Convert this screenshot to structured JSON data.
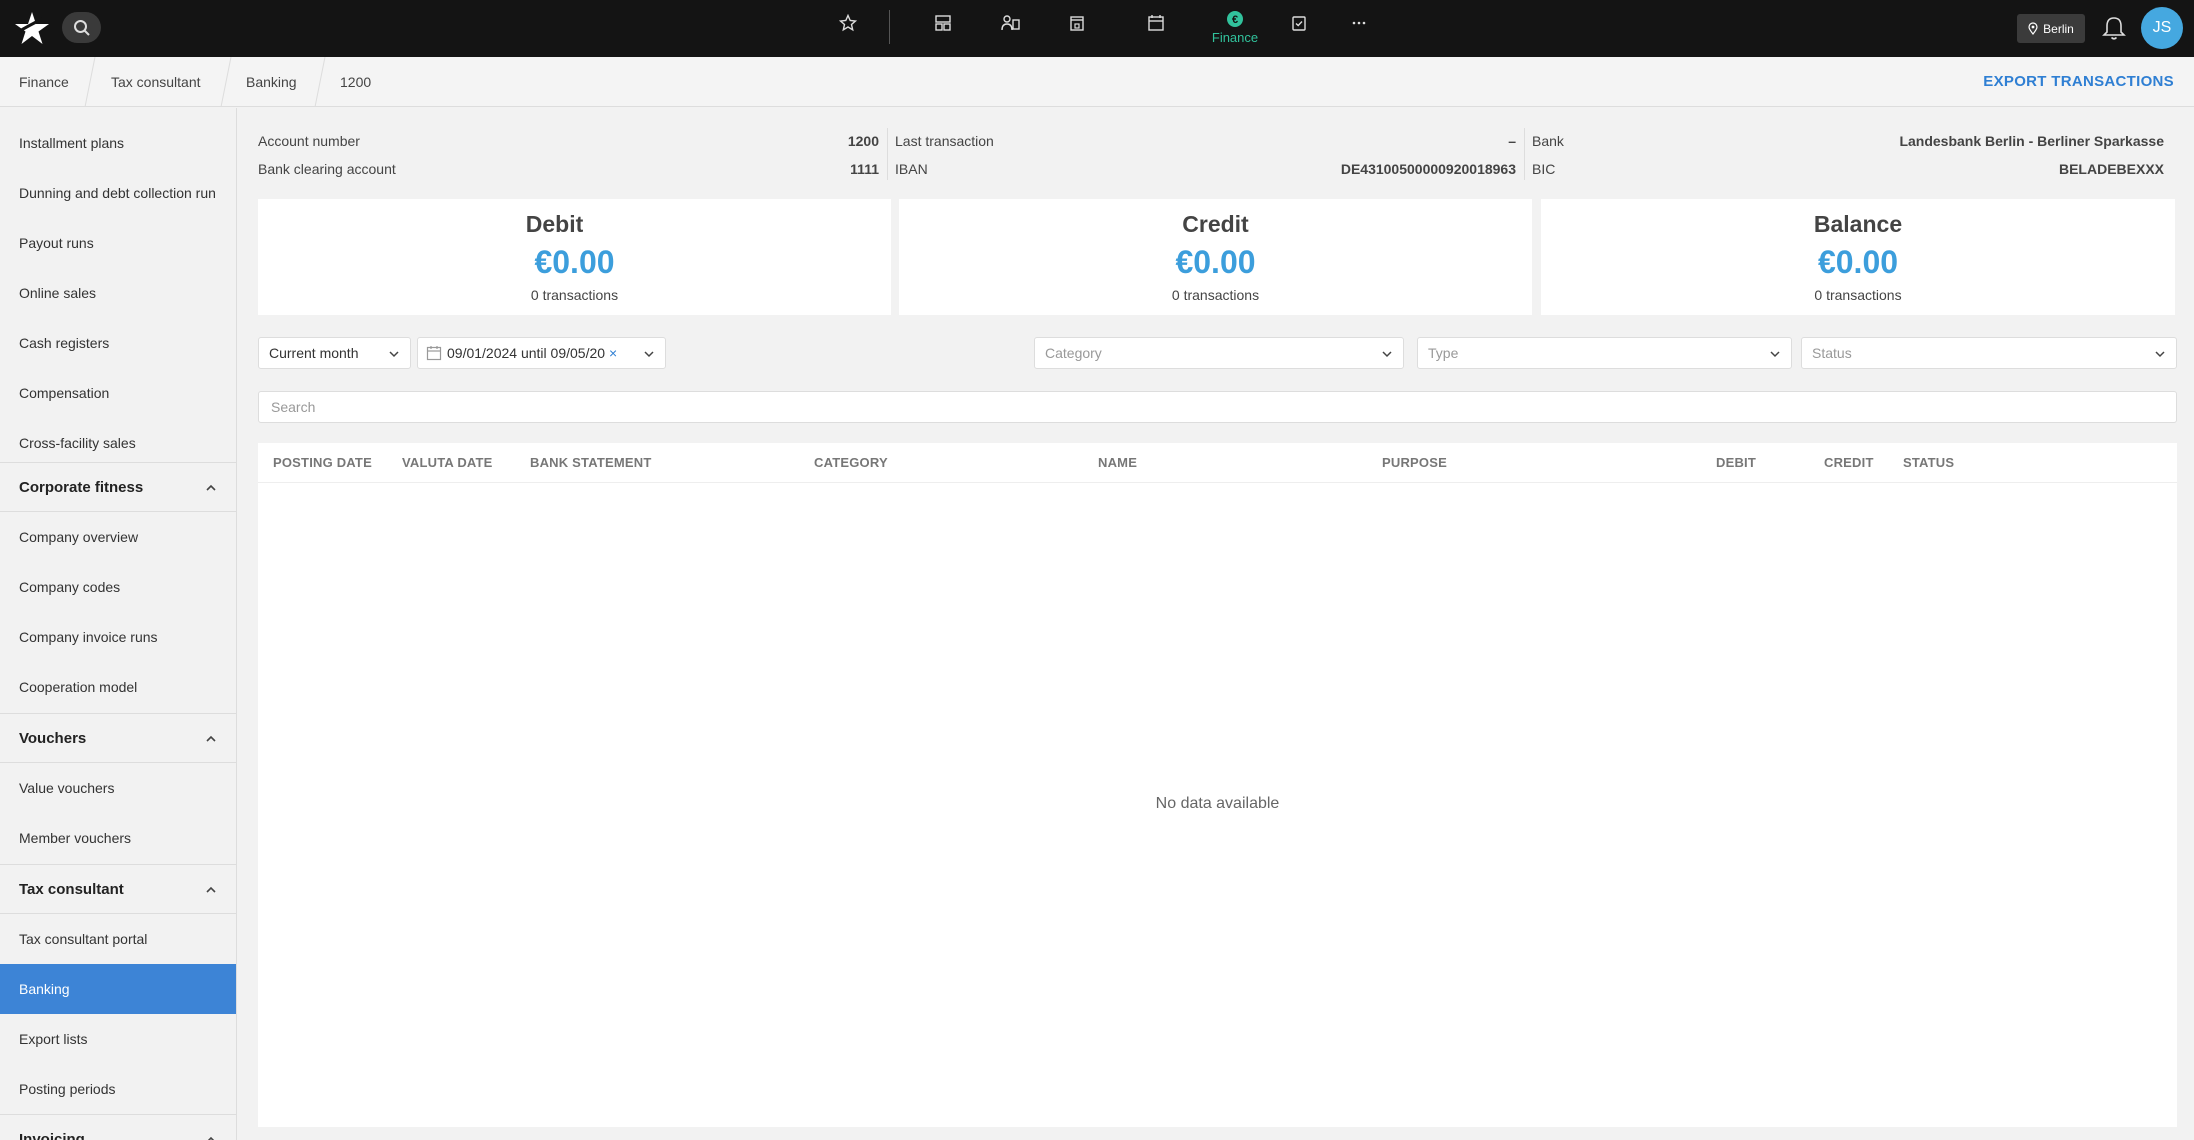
{
  "topbar": {
    "location": "Berlin",
    "active_nav_label": "Finance",
    "user_initials": "JS",
    "nav_icons": [
      "star-icon",
      "dashboard-icon",
      "members-icon",
      "bookings-icon",
      "calendar-icon",
      "finance-icon",
      "tasks-icon",
      "more-icon"
    ]
  },
  "breadcrumb": [
    "Finance",
    "Tax consultant",
    "Banking",
    "1200"
  ],
  "export_label": "EXPORT TRANSACTIONS",
  "sidebar": {
    "items_top": [
      "Installment plans",
      "Dunning and debt collection run",
      "Payout runs",
      "Online sales",
      "Cash registers",
      "Compensation",
      "Cross-facility sales"
    ],
    "group_corporate": "Corporate fitness",
    "items_corporate": [
      "Company overview",
      "Company codes",
      "Company invoice runs",
      "Cooperation model"
    ],
    "group_vouchers": "Vouchers",
    "items_vouchers": [
      "Value vouchers",
      "Member vouchers"
    ],
    "group_tax": "Tax consultant",
    "items_tax": [
      "Tax consultant portal",
      "Banking",
      "Export lists",
      "Posting periods"
    ],
    "group_invoicing": "Invoicing"
  },
  "account": {
    "account_number_label": "Account number",
    "account_number": "1200",
    "clearing_label": "Bank clearing account",
    "clearing_value": "1111",
    "last_transaction_label": "Last transaction",
    "last_transaction": "–",
    "iban_label": "IBAN",
    "iban": "DE43100500000920018963",
    "bank_label": "Bank",
    "bank": "Landesbank Berlin - Berliner Sparkasse",
    "bic_label": "BIC",
    "bic": "BELADEBEXXX"
  },
  "summary": [
    {
      "title": "Debit",
      "amount": "€0.00",
      "count": "0 transactions"
    },
    {
      "title": "Credit",
      "amount": "€0.00",
      "count": "0 transactions"
    },
    {
      "title": "Balance",
      "amount": "€0.00",
      "count": "0 transactions"
    }
  ],
  "filters": {
    "period": "Current month",
    "date_range": "09/01/2024 until 09/05/20",
    "category_placeholder": "Category",
    "type_placeholder": "Type",
    "status_placeholder": "Status",
    "search_placeholder": "Search"
  },
  "table": {
    "columns": [
      "POSTING DATE",
      "VALUTA DATE",
      "BANK STATEMENT",
      "CATEGORY",
      "NAME",
      "PURPOSE",
      "DEBIT",
      "CREDIT",
      "STATUS"
    ],
    "empty_text": "No data available"
  }
}
